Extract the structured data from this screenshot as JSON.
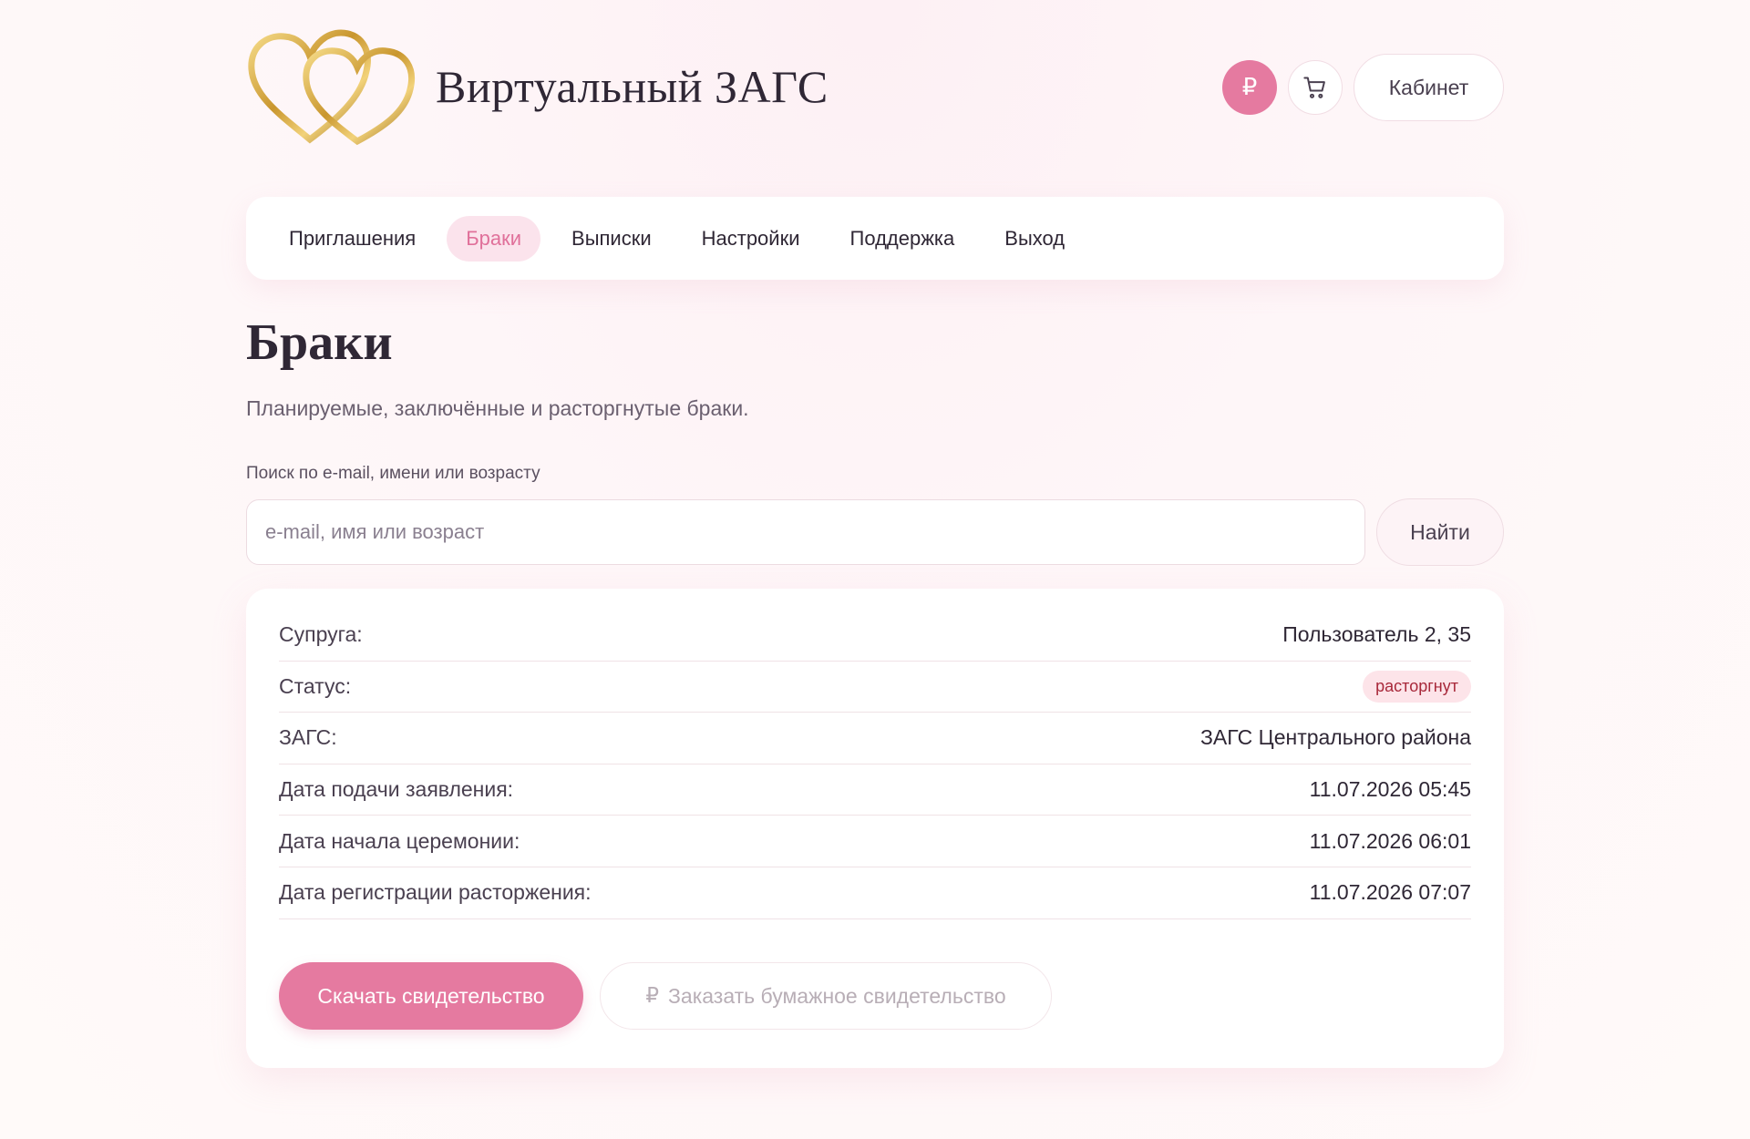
{
  "header": {
    "site_title": "Виртуальный ЗАГС",
    "ruble_icon": "₽",
    "cart_icon": "cart-icon",
    "cabinet_label": "Кабинет"
  },
  "nav": {
    "items": [
      {
        "label": "Приглашения",
        "active": false
      },
      {
        "label": "Браки",
        "active": true
      },
      {
        "label": "Выписки",
        "active": false
      },
      {
        "label": "Настройки",
        "active": false
      },
      {
        "label": "Поддержка",
        "active": false
      },
      {
        "label": "Выход",
        "active": false
      }
    ]
  },
  "page": {
    "title": "Браки",
    "subtitle": "Планируемые, заключённые и расторгнутые браки."
  },
  "search": {
    "label": "Поиск по e-mail, имени или возрасту",
    "placeholder": "e-mail, имя или возраст",
    "value": "",
    "button_label": "Найти"
  },
  "marriage": {
    "rows": [
      {
        "key": "Супруга:",
        "value": "Пользователь 2, 35"
      },
      {
        "key": "Статус:",
        "value": "расторгнут",
        "badge": true
      },
      {
        "key": "ЗАГС:",
        "value": "ЗАГС Центрального района"
      },
      {
        "key": "Дата подачи заявления:",
        "value": "11.07.2026 05:45"
      },
      {
        "key": "Дата начала церемонии:",
        "value": "11.07.2026 06:01"
      },
      {
        "key": "Дата регистрации расторжения:",
        "value": "11.07.2026 07:07"
      }
    ],
    "download_label": "Скачать свидетельство",
    "order_icon": "₽",
    "order_label": "Заказать бумажное свидетельство"
  },
  "colors": {
    "accent": "#e57aa0",
    "active_nav_bg": "#fbe3ec",
    "badge_bg": "#fde4e9",
    "badge_text": "#a8283a"
  }
}
